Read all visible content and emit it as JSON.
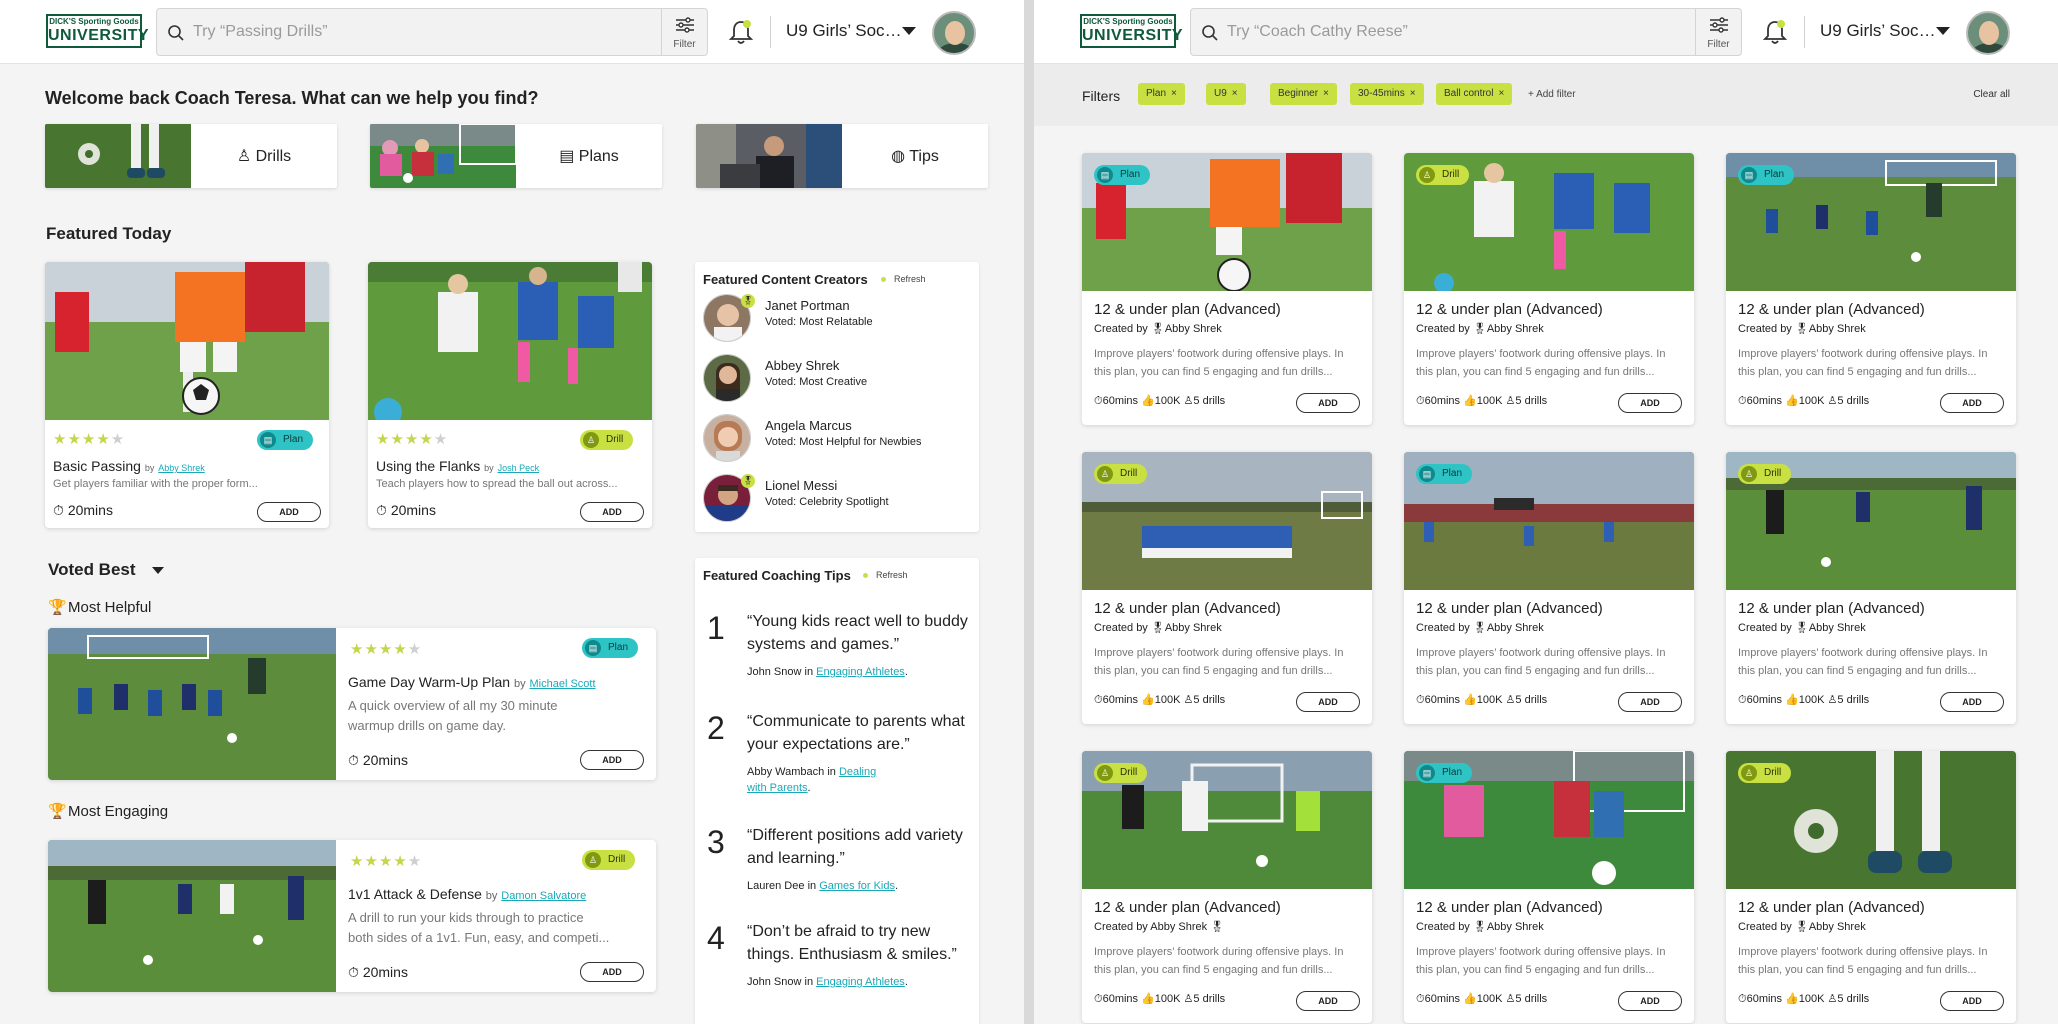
{
  "brand": {
    "logo_top": "DICK'S Sporting Goods",
    "logo_bottom": "UNIVERSITY"
  },
  "screen1": {
    "search": {
      "placeholder": "Try “Passing Drills”",
      "filter_label": "Filter"
    },
    "team": "U9 Girls’ Socc...",
    "welcome": "Welcome back Coach Teresa. What can we help you find?",
    "categories": [
      {
        "label": "Drills",
        "icon": "cone-icon"
      },
      {
        "label": "Plans",
        "icon": "clipboard-icon"
      },
      {
        "label": "Tips",
        "icon": "lightbulb-icon"
      }
    ],
    "featured_today": {
      "heading": "Featured Today",
      "cards": [
        {
          "rating": 4,
          "tag": "Plan",
          "title": "Basic Passing",
          "by": "by",
          "author": "Abby Shrek",
          "desc": "Get players familiar with the proper form...",
          "duration": "20mins",
          "add": "ADD"
        },
        {
          "rating": 4,
          "tag": "Drill",
          "title": "Using the Flanks",
          "by": "by",
          "author": "Josh Peck",
          "desc": "Teach players how to spread the ball out across...",
          "duration": "20mins",
          "add": "ADD"
        }
      ]
    },
    "creators": {
      "title": "Featured Content Creators",
      "refresh": "Refresh",
      "items": [
        {
          "name": "Janet Portman",
          "voted": "Voted: Most Relatable"
        },
        {
          "name": "Abbey Shrek",
          "voted": "Voted: Most Creative"
        },
        {
          "name": "Angela Marcus",
          "voted": "Voted: Most Helpful for Newbies"
        },
        {
          "name": "Lionel Messi",
          "voted": "Voted: Celebrity Spotlight"
        }
      ]
    },
    "voted_best": {
      "heading": "Voted Best",
      "groups": [
        {
          "label": "Most Helpful",
          "rating": 4,
          "tag": "Plan",
          "title": "Game Day Warm-Up Plan",
          "by": "by",
          "author": "Michael Scott",
          "desc1": "A quick overview of all my 30 minute",
          "desc2": "warmup drills on game day.",
          "duration": "20mins",
          "add": "ADD"
        },
        {
          "label": "Most Engaging",
          "rating": 4,
          "tag": "Drill",
          "title": "1v1 Attack & Defense",
          "by": "by",
          "author": "Damon Salvatore",
          "desc1": "A drill to run your kids through to practice",
          "desc2": "both sides of a 1v1. Fun, easy, and competi...",
          "duration": "20mins",
          "add": "ADD"
        }
      ]
    },
    "tips": {
      "title": "Featured Coaching Tips",
      "refresh": "Refresh",
      "items": [
        {
          "num": "1",
          "quote": "“Young kids react well to buddy systems and games.”",
          "author": "John Snow",
          "in": "in",
          "topic": "Engaging Athletes",
          "end": "."
        },
        {
          "num": "2",
          "quote": "“Communicate to parents what your expectations are.”",
          "author": "Abby Wambach",
          "in": "in",
          "topic": "Dealing with Parents",
          "end": "."
        },
        {
          "num": "3",
          "quote": "“Different positions add variety and learning.”",
          "author": "Lauren Dee",
          "in": "in",
          "topic": "Games for Kids",
          "end": "."
        },
        {
          "num": "4",
          "quote": "“Don’t be afraid to try new things. Enthusiasm & smiles.”",
          "author": "John Snow",
          "in": "in",
          "topic": "Engaging Athletes",
          "end": "."
        }
      ]
    }
  },
  "screen2": {
    "search": {
      "placeholder": "Try “Coach Cathy Reese”",
      "filter_label": "Filter"
    },
    "team": "U9 Girls’ Socc...",
    "filters": {
      "label": "Filters",
      "chips": [
        "Plan",
        "U9",
        "Beginner",
        "30-45mins",
        "Ball control"
      ],
      "add_filter": "+ Add filter",
      "clear_all": "Clear all"
    },
    "grid": [
      {
        "tag": "Plan",
        "title": "12 & under plan (Advanced)",
        "created": "Created by 🎖Abby Shrek",
        "desc": "Improve players’ footwork during offensive plays. In this plan, you can find 5 engaging and fun drills...",
        "meta": "⏱60mins 👍100K ♙5 drills",
        "add": "ADD"
      },
      {
        "tag": "Drill",
        "title": "12 & under plan (Advanced)",
        "created": "Created by 🎖Abby Shrek",
        "desc": "Improve players’ footwork during offensive plays. In this plan, you can find 5 engaging and fun drills...",
        "meta": "⏱60mins 👍100K ♙5 drills",
        "add": "ADD"
      },
      {
        "tag": "Plan",
        "title": "12 & under plan (Advanced)",
        "created": "Created by 🎖Abby Shrek",
        "desc": "Improve players’ footwork during offensive plays. In this plan, you can find 5 engaging and fun drills...",
        "meta": "⏱60mins 👍100K ♙5 drills",
        "add": "ADD"
      },
      {
        "tag": "Drill",
        "title": "12 & under plan (Advanced)",
        "created": "Created by 🎖Abby Shrek",
        "desc": "Improve players’ footwork during offensive plays. In this plan, you can find 5 engaging and fun drills...",
        "meta": "⏱60mins 👍100K ♙5 drills",
        "add": "ADD"
      },
      {
        "tag": "Plan",
        "title": "12 & under plan (Advanced)",
        "created": "Created by 🎖Abby Shrek",
        "desc": "Improve players’ footwork during offensive plays. In this plan, you can find 5 engaging and fun drills...",
        "meta": "⏱60mins 👍100K ♙5 drills",
        "add": "ADD"
      },
      {
        "tag": "Drill",
        "title": "12 & under plan (Advanced)",
        "created": "Created by 🎖Abby Shrek",
        "desc": "Improve players’ footwork during offensive plays. In this plan, you can find 5 engaging and fun drills...",
        "meta": "⏱60mins 👍100K ♙5 drills",
        "add": "ADD"
      },
      {
        "tag": "Drill",
        "title": "12 & under plan (Advanced)",
        "created": "Created by Abby Shrek 🎖",
        "desc": "Improve players’ footwork during offensive plays. In this plan, you can find 5 engaging and fun drills...",
        "meta": "⏱60mins 👍100K ♙5 drills",
        "add": "ADD"
      },
      {
        "tag": "Plan",
        "title": "12 & under plan (Advanced)",
        "created": "Created by 🎖Abby Shrek",
        "desc": "Improve players’ footwork during offensive plays. In this plan, you can find 5 engaging and fun drills...",
        "meta": "⏱60mins 👍100K ♙5 drills",
        "add": "ADD"
      },
      {
        "tag": "Drill",
        "title": "12 & under plan (Advanced)",
        "created": "Created by 🎖Abby Shrek",
        "desc": "Improve players’ footwork during offensive plays. In this plan, you can find 5 engaging and fun drills...",
        "meta": "⏱60mins 👍100K ♙5 drills",
        "add": "ADD"
      }
    ]
  }
}
